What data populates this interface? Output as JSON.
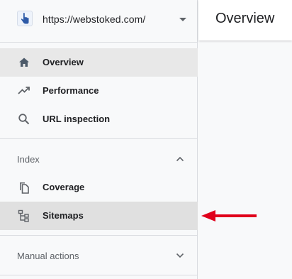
{
  "property": {
    "url": "https://webstoked.com/",
    "icon": "site-favicon-icon"
  },
  "nav": {
    "items": [
      {
        "label": "Overview",
        "icon": "home-icon"
      },
      {
        "label": "Performance",
        "icon": "trending-up-icon"
      },
      {
        "label": "URL inspection",
        "icon": "search-icon"
      }
    ]
  },
  "index": {
    "title": "Index",
    "items": [
      {
        "label": "Coverage",
        "icon": "copy-pages-icon"
      },
      {
        "label": "Sitemaps",
        "icon": "sitemap-tree-icon"
      }
    ]
  },
  "manual_actions": {
    "title": "Manual actions"
  },
  "header": {
    "title": "Overview"
  },
  "colors": {
    "annotation_arrow": "#e0001b",
    "selected_bg": "#e0e0e0",
    "accent_icon": "#5f6368"
  }
}
